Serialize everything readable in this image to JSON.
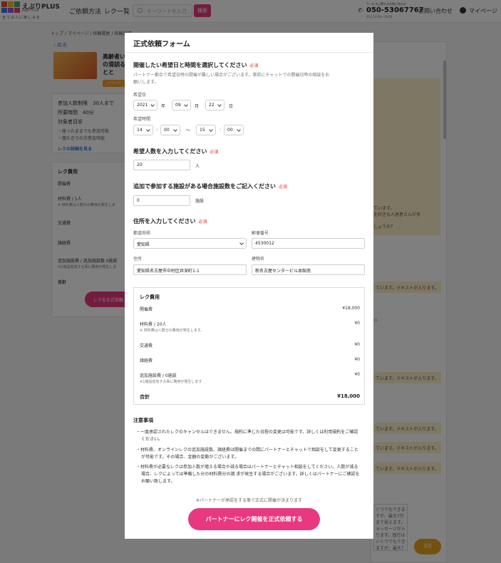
{
  "header": {
    "logo_name": "えぷりPLUS",
    "logo_sub": "ENJOY PLUS",
    "logo_tagline": "全ての人に楽しみを",
    "nav": [
      "ご依頼方法",
      "レク一覧"
    ],
    "search_placeholder": "キーワードを入力",
    "search_button": "検索",
    "tel_caption": "サービスに関するお問い合わせ",
    "tel_number": "050-53067767",
    "tel_hours": "平日 10:00〜18:00",
    "inquiry": "お問い合わせ",
    "mypage": "マイページ"
  },
  "background": {
    "breadcrumb": "トップ / マイページ / 依頼履歴 / 依頼詳細",
    "back": "戻る",
    "event_title": "高齢者い口の滑訓るひとと",
    "event_badge": "イベント",
    "info": [
      "参加人数制限　30人まで",
      "所要時間　40分",
      "対象者目安"
    ],
    "info_bullets": [
      "・座ったままでも参加可能",
      "・寝たきりの方参加可能"
    ],
    "info_link": "レクの詳細を見る",
    "fee_title": "レク費用",
    "fee_lines": [
      "開催費",
      "材料費 / 1人",
      "※ 材料費は人数分の費用が発生しま",
      "交通費",
      "諸経費",
      "追加施設費 / 追加施設数 0施設",
      "※1施設追加する事に費用が発生しま",
      "合計"
    ],
    "fee_cta": "レクを正式依頼",
    "chat_bubbles": [
      "ています。テキストが入ります。",
      "ています。テキストが入ります。",
      "ています。テキストが入ります。",
      "ています。テキストが入ります。",
      "ています。テキストが入ります。",
      "ています。テキストが入ります。"
    ],
    "chat_inner_lines": [
      "ています。",
      "を好きな人居者さんが多",
      "しょうか？"
    ],
    "chat_meta": "21",
    "chat_input_text": "くつでもできますが、最大7行まで見えます。メッセージが入ります。改行はいくつでもできますが、最大7行まで見えます。メッセージが入ります。",
    "send": "送信"
  },
  "modal": {
    "title": "正式依頼フォーム",
    "required": "必須",
    "schedule": {
      "heading": "開催したい希望日と時間を選択してください",
      "note_line1": "パートナー都合で希望日時の開催が難しい場合がございます。事前にチャットでの開催日時の相談をお",
      "note_line2": "願いします。",
      "date_label": "希望日",
      "year": "2021",
      "year_unit": "年",
      "month": "09",
      "month_unit": "月",
      "day": "22",
      "day_unit": "日",
      "time_label": "希望時間",
      "start_hour": "14",
      "start_min": "00",
      "colon": ":",
      "tilde": "〜",
      "end_hour": "15",
      "end_min": "00"
    },
    "people": {
      "heading": "希望人数を入力してください",
      "value": "20",
      "unit": "人"
    },
    "facilities": {
      "heading": "追加で参加する施設がある場合施設数をご記入ください",
      "value": "0",
      "unit": "施設"
    },
    "address": {
      "heading": "住所を入力してください",
      "pref_label": "都道府県",
      "pref_value": "愛知県",
      "zip_label": "郵便番号",
      "zip_value": "4530012",
      "addr_label": "住所",
      "addr_value": "愛知県名古屋市中村区井深町1-1",
      "bldg_label": "建物名",
      "bldg_value": "新名古屋センタービル本館南"
    },
    "fees": {
      "title": "レク費用",
      "rows": [
        {
          "label": "開催費",
          "value": "¥18,000"
        },
        {
          "label": "材料費 / 20人",
          "value": "¥0"
        },
        {
          "label": "交通費",
          "value": "¥0"
        },
        {
          "label": "諸経費",
          "value": "¥0"
        },
        {
          "label": "追加施設費 / 0施設",
          "value": "¥0"
        }
      ],
      "material_note": "※ 材料費は人数分の費用が発生します。",
      "facility_note": "※1施設追加する事に費用が発生します",
      "total_label": "合計",
      "total_value": "¥18,000"
    },
    "notice": {
      "title": "注意事項",
      "items": [
        "・一度承認されたレクのキャンセルはできません。規約に準じた日程の変更は可能です。詳しくは利用規約をご確認ください。",
        "・材料費、オンラインレクの追加施設数、諸経費は開催までの間にパートナーとチャットで相談をして変更することが可能です。その場合、金額の変動がございます。",
        "・材料費が必要なレクは参加人数が増える場合や減る場合はパートナーとチャット相談をしてください。人数が減る場合、レクによっては準備した分の材料費分の請 求が発生する場合がございます。詳しくはパートナーにご確認をお願い致します。"
      ]
    },
    "footer_note": "※パートナーが承認をする事で正式に開催が決まります",
    "submit": "パートナーにレク開催を正式依頼する"
  },
  "colors": {
    "accent_pink": "#e8387f",
    "required_red": "#e53935",
    "chat_yellow": "#fcefc7",
    "send_orange": "#e8a21c",
    "link_blue": "#3b6fd6"
  }
}
